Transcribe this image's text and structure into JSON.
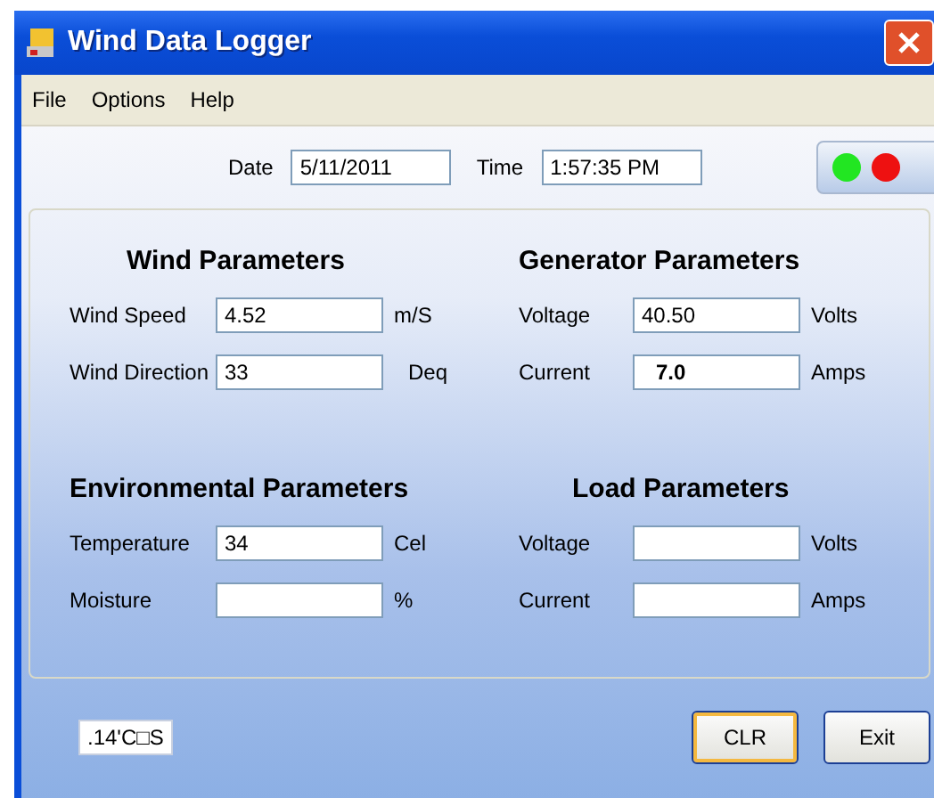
{
  "window": {
    "title": "Wind Data Logger"
  },
  "menu": [
    {
      "label": "File"
    },
    {
      "label": "Options"
    },
    {
      "label": "Help"
    }
  ],
  "date": {
    "label": "Date",
    "value": "5/11/2011"
  },
  "time": {
    "label": "Time",
    "value": "1:57:35 PM"
  },
  "lights": [
    {
      "color": "#22e622"
    },
    {
      "color": "#ee1111"
    }
  ],
  "sections": [
    {
      "title": "Wind Parameters",
      "rows": [
        {
          "label": "Wind Speed",
          "value": "4.52",
          "unit": "m/S",
          "bold": false
        },
        {
          "label": "Wind Direction",
          "value": "33",
          "unit": "Deq",
          "bold": false
        }
      ]
    },
    {
      "title": "Generator Parameters",
      "rows": [
        {
          "label": "Voltage",
          "value": "40.50",
          "unit": "Volts",
          "bold": false
        },
        {
          "label": "Current",
          "value": "7.0",
          "unit": "Amps",
          "bold": true
        }
      ]
    },
    {
      "title": "Environmental Parameters",
      "rows": [
        {
          "label": "Temperature",
          "value": "34",
          "unit": "Cel",
          "bold": false
        },
        {
          "label": "Moisture",
          "unit": "%"
        }
      ]
    },
    {
      "title": "Load Parameters",
      "rows": [
        {
          "label": "Voltage",
          "unit": "Volts"
        },
        {
          "label": "Current",
          "unit": "Amps"
        }
      ]
    }
  ],
  "status": ".14'C□S",
  "buttons": [
    {
      "label": "CLR",
      "focused": true
    },
    {
      "label": "Exit",
      "focused": false
    }
  ]
}
